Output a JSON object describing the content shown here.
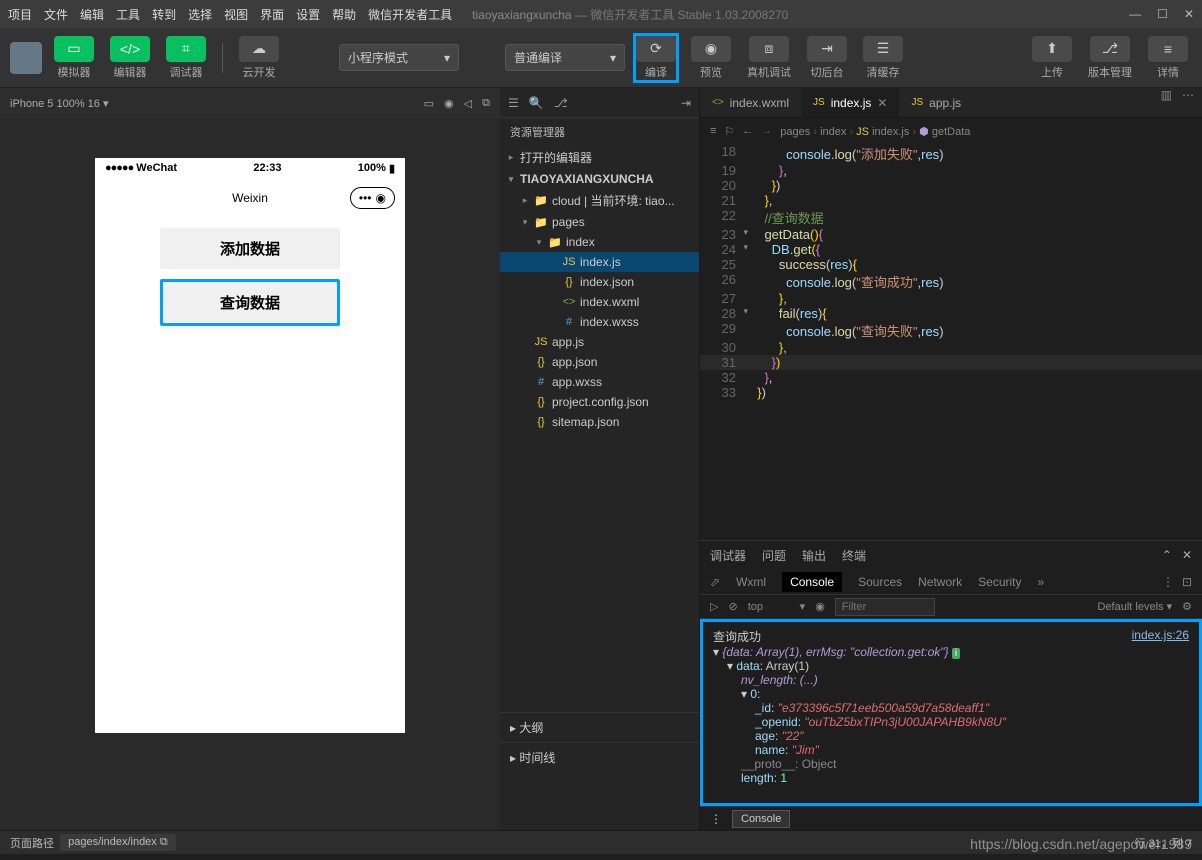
{
  "titlebar": {
    "menus": [
      "项目",
      "文件",
      "编辑",
      "工具",
      "转到",
      "选择",
      "视图",
      "界面",
      "设置",
      "帮助",
      "微信开发者工具"
    ],
    "project": "tiaoyaxiangxuncha",
    "suffix": "— 微信开发者工具 Stable 1.03.2008270"
  },
  "toolbar": {
    "simulator": "模拟器",
    "editor": "编辑器",
    "debugger": "调试器",
    "cloud": "云开发",
    "mode_dropdown": "小程序模式",
    "compile_dropdown": "普通编译",
    "compile": "编译",
    "preview": "预览",
    "remote": "真机调试",
    "backstage": "切后台",
    "clearcache": "清缓存",
    "upload": "上传",
    "version": "版本管理",
    "details": "详情"
  },
  "sim": {
    "header": "iPhone 5 100% 16 ▾",
    "carrier": "WeChat",
    "time": "22:33",
    "battery": "100%",
    "navtitle": "Weixin",
    "btn1": "添加数据",
    "btn2": "查询数据"
  },
  "explorer": {
    "title": "资源管理器",
    "opened": "打开的编辑器",
    "project": "TIAOYAXIANGXUNCHA",
    "items": [
      {
        "indent": 1,
        "arrow": "▸",
        "icon": "📁",
        "label": "cloud | 当前环境: tiao...",
        "color": "#dcb67a"
      },
      {
        "indent": 1,
        "arrow": "▾",
        "icon": "📁",
        "label": "pages",
        "color": "#c09553"
      },
      {
        "indent": 2,
        "arrow": "▾",
        "icon": "📁",
        "label": "index",
        "color": "#90a4ae"
      },
      {
        "indent": 3,
        "arrow": "",
        "icon": "JS",
        "label": "index.js",
        "color": "#e6c84c",
        "selected": true
      },
      {
        "indent": 3,
        "arrow": "",
        "icon": "{}",
        "label": "index.json",
        "color": "#e6c84c"
      },
      {
        "indent": 3,
        "arrow": "",
        "icon": "<>",
        "label": "index.wxml",
        "color": "#6cb33f"
      },
      {
        "indent": 3,
        "arrow": "",
        "icon": "#",
        "label": "index.wxss",
        "color": "#5a9fd4"
      },
      {
        "indent": 1,
        "arrow": "",
        "icon": "JS",
        "label": "app.js",
        "color": "#e6c84c"
      },
      {
        "indent": 1,
        "arrow": "",
        "icon": "{}",
        "label": "app.json",
        "color": "#e6c84c"
      },
      {
        "indent": 1,
        "arrow": "",
        "icon": "#",
        "label": "app.wxss",
        "color": "#5a9fd4"
      },
      {
        "indent": 1,
        "arrow": "",
        "icon": "{}",
        "label": "project.config.json",
        "color": "#e6c84c"
      },
      {
        "indent": 1,
        "arrow": "",
        "icon": "{}",
        "label": "sitemap.json",
        "color": "#e6c84c"
      }
    ],
    "outline": "大纲",
    "timeline": "时间线"
  },
  "tabs": [
    {
      "icon": "<>",
      "label": "index.wxml",
      "active": false,
      "color": "#6cb33f"
    },
    {
      "icon": "JS",
      "label": "index.js",
      "active": true,
      "color": "#e6c84c"
    },
    {
      "icon": "JS",
      "label": "app.js",
      "active": false,
      "color": "#e6c84c"
    }
  ],
  "breadcrumb": [
    "pages",
    "index",
    "index.js",
    "getData"
  ],
  "code": [
    {
      "n": 18,
      "html": "          <span class='kw-var'>console</span>.<span class='kw-yellow'>log</span>(<span class='kw-string'>\"添加失败\"</span>,<span class='kw-var'>res</span>)"
    },
    {
      "n": 19,
      "html": "        <span class='kw-brace2'>}</span>,"
    },
    {
      "n": 20,
      "html": "      <span class='kw-brace'>}</span>)"
    },
    {
      "n": 21,
      "html": "    <span class='kw-brace'>}</span>,"
    },
    {
      "n": 22,
      "html": "    <span class='kw-comment'>//查询数据</span>"
    },
    {
      "n": 23,
      "fold": "▾",
      "html": "    <span class='kw-yellow'>getData</span><span class='kw-brace'>()</span><span class='kw-brace2'>{</span>"
    },
    {
      "n": 24,
      "fold": "▾",
      "html": "      <span class='kw-var'>DB</span>.<span class='kw-yellow'>get</span><span class='kw-brace'>(</span><span class='kw-brace2'>{</span>"
    },
    {
      "n": 25,
      "html": "        <span class='kw-yellow'>success</span>(<span class='kw-var'>res</span>)<span class='kw-brace'>{</span>"
    },
    {
      "n": 26,
      "html": "          <span class='kw-var'>console</span>.<span class='kw-yellow'>log</span>(<span class='kw-string'>\"查询成功\"</span>,<span class='kw-var'>res</span>)"
    },
    {
      "n": 27,
      "html": "        <span class='kw-brace'>}</span>,"
    },
    {
      "n": 28,
      "fold": "▾",
      "html": "        <span class='kw-yellow'>fail</span>(<span class='kw-var'>res</span>)<span class='kw-brace'>{</span>"
    },
    {
      "n": 29,
      "html": "          <span class='kw-var'>console</span>.<span class='kw-yellow'>log</span>(<span class='kw-string'>\"查询失败\"</span>,<span class='kw-var'>res</span>)"
    },
    {
      "n": 30,
      "html": "        <span class='kw-brace'>}</span>,"
    },
    {
      "n": 31,
      "hl": true,
      "html": "      <span class='kw-brace2'>}</span><span class='kw-brace'>)</span>"
    },
    {
      "n": 32,
      "html": "    <span class='kw-brace2'>}</span>,"
    },
    {
      "n": 33,
      "html": "  <span class='kw-brace'>}</span>)"
    }
  ],
  "dbg": {
    "tabs": [
      "调试器",
      "问题",
      "输出",
      "终端"
    ],
    "devtabs": [
      "Wxml",
      "Console",
      "Sources",
      "Network",
      "Security"
    ],
    "filter_top": "top",
    "filter_placeholder": "Filter",
    "levels": "Default levels ▾",
    "msg": "查询成功",
    "link": "index.js:26",
    "obj_summary": "{data: Array(1), errMsg: \"collection.get:ok\"}",
    "data_label": "data: Array(1)",
    "nv": "nv_length: (...)",
    "idx": "0:",
    "_id": "\"e373396c5f71eeb500a59d7a58deaff1\"",
    "_openid": "\"ouTbZ5bxTIPn3jU00JAPAHB9kN8U\"",
    "age": "\"22\"",
    "name": "\"Jim\"",
    "proto": "__proto__: Object",
    "length": "length: 1",
    "console_btn": "Console"
  },
  "status": {
    "path_label": "页面路径",
    "path": "pages/index/index",
    "pos": "行 31，列 7"
  },
  "watermark": "https://blog.csdn.net/agepower1989"
}
